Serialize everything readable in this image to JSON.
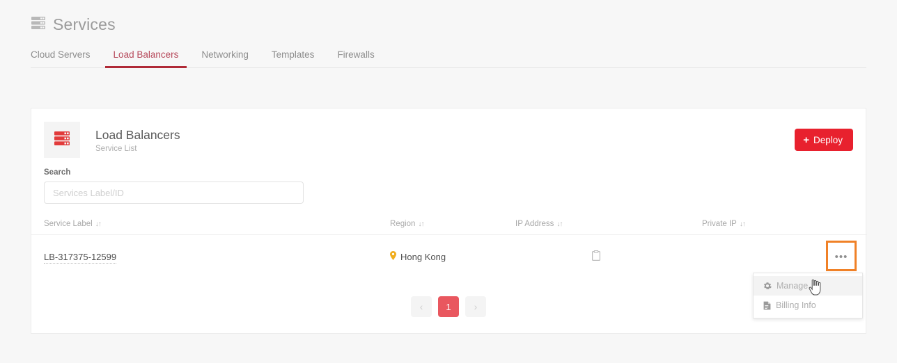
{
  "header": {
    "title": "Services",
    "icon": "server-stack-icon"
  },
  "tabs": [
    {
      "label": "Cloud Servers",
      "active": false
    },
    {
      "label": "Load Balancers",
      "active": true
    },
    {
      "label": "Networking",
      "active": false
    },
    {
      "label": "Templates",
      "active": false
    },
    {
      "label": "Firewalls",
      "active": false
    }
  ],
  "card": {
    "icon": "server-stack-icon",
    "title": "Load Balancers",
    "subtitle": "Service List",
    "deploy_label": "Deploy",
    "deploy_plus": "+"
  },
  "search": {
    "label": "Search",
    "placeholder": "Services Label/ID",
    "value": ""
  },
  "table": {
    "columns": [
      {
        "label": "Service Label",
        "sort": "↓↑"
      },
      {
        "label": "Region",
        "sort": "↓↑"
      },
      {
        "label": "IP Address",
        "sort": "↓↑"
      },
      {
        "label": "Private IP",
        "sort": "↓↑"
      }
    ],
    "rows": [
      {
        "service_label": "LB-317375-12599",
        "region": "Hong Kong",
        "region_icon": "map-pin-icon",
        "ip_address": "",
        "ip_copy_icon": "clipboard-copy-icon",
        "private_ip": "",
        "actions_icon": "•••"
      }
    ]
  },
  "dropdown": {
    "items": [
      {
        "label": "Manage",
        "icon": "gear-icon",
        "hovered": true
      },
      {
        "label": "Billing Info",
        "icon": "file-invoice-icon",
        "hovered": false
      }
    ]
  },
  "pagination": {
    "prev": "‹",
    "next": "›",
    "pages": [
      "1"
    ],
    "current": "1"
  },
  "colors": {
    "brand_red": "#e8212e",
    "tab_active": "#b02a37",
    "pager_active": "#e9575f",
    "highlight_orange": "#f08127",
    "region_pin": "#f0ad1e"
  }
}
